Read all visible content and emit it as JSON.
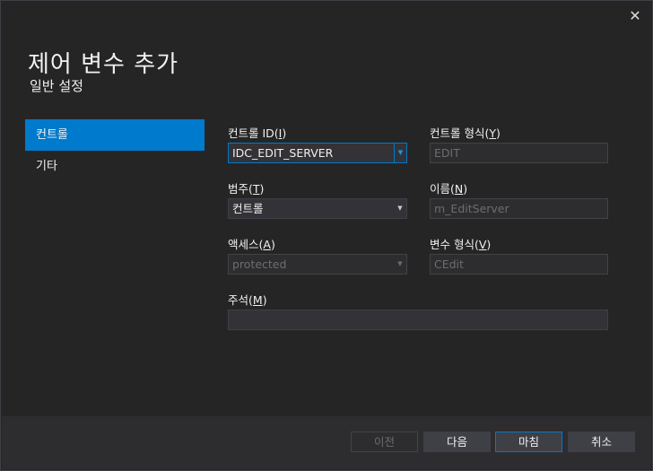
{
  "dialog": {
    "close_icon": "✕",
    "title": "제어 변수 추가",
    "subtitle": "일반 설정"
  },
  "nav": {
    "items": [
      {
        "label": "컨트롤",
        "active": true
      },
      {
        "label": "기타",
        "active": false
      }
    ]
  },
  "form": {
    "control_id": {
      "label_pre": "컨트롤 ID(",
      "mnemonic": "I",
      "label_post": ")",
      "value": "IDC_EDIT_SERVER"
    },
    "control_type": {
      "label_pre": "컨트롤 형식(",
      "mnemonic": "Y",
      "label_post": ")",
      "value": "EDIT"
    },
    "category": {
      "label_pre": "범주(",
      "mnemonic": "T",
      "label_post": ")",
      "value": "컨트롤"
    },
    "name": {
      "label_pre": "이름(",
      "mnemonic": "N",
      "label_post": ")",
      "value": "m_EditServer"
    },
    "access": {
      "label_pre": "액세스(",
      "mnemonic": "A",
      "label_post": ")",
      "value": "protected"
    },
    "variable_type": {
      "label_pre": "변수 형식(",
      "mnemonic": "V",
      "label_post": ")",
      "value": "CEdit"
    },
    "comment": {
      "label_pre": "주석(",
      "mnemonic": "M",
      "label_post": ")",
      "value": ""
    }
  },
  "footer": {
    "prev_label": "이전",
    "next_label": "다음",
    "finish_label": "마침",
    "cancel_label": "취소"
  },
  "colors": {
    "accent": "#007acc",
    "background": "#252526",
    "footer": "#2d2d30"
  },
  "icons": {
    "dropdown": "chevron-down-icon",
    "close": "close-icon"
  }
}
